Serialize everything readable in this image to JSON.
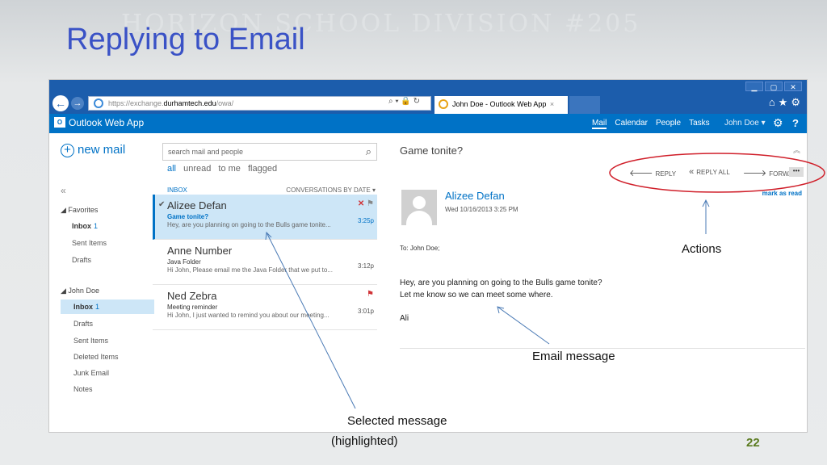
{
  "slide": {
    "title": "Replying to Email",
    "watermark": "HORIZON SCHOOL DIVISION #205",
    "page_number": "22"
  },
  "browser": {
    "url_prefix": "https://exchange.",
    "url_domain": "durhamtech.edu",
    "url_path": "/owa/",
    "tab_title": "John Doe - Outlook Web App",
    "tab_close": "×"
  },
  "owa": {
    "app_name": "Outlook Web App",
    "nav": [
      "Mail",
      "Calendar",
      "People",
      "Tasks"
    ],
    "user": "John Doe ▾"
  },
  "left_pane": {
    "new_mail": "new mail",
    "collapse": "«",
    "favorites_label": "◢ Favorites",
    "favorites": [
      {
        "label": "Inbox",
        "count": "1"
      },
      {
        "label": "Sent Items",
        "count": ""
      },
      {
        "label": "Drafts",
        "count": ""
      }
    ],
    "account_label": "◢ John Doe",
    "folders": [
      {
        "label": "Inbox",
        "count": "1"
      },
      {
        "label": "Drafts",
        "count": ""
      },
      {
        "label": "Sent Items",
        "count": ""
      },
      {
        "label": "Deleted Items",
        "count": ""
      },
      {
        "label": "Junk Email",
        "count": ""
      },
      {
        "label": "Notes",
        "count": ""
      }
    ]
  },
  "message_list": {
    "search_placeholder": "search mail and people",
    "filters": [
      "all",
      "unread",
      "to me",
      "flagged"
    ],
    "folder": "INBOX",
    "sort": "CONVERSATIONS BY DATE ▾",
    "messages": [
      {
        "sender": "Alizee Defan",
        "subject": "Game tonite?",
        "preview": "Hey, are you planning on going to the Bulls game tonite...",
        "time": "3:25p"
      },
      {
        "sender": "Anne Number",
        "subject": "Java Folder",
        "preview": "Hi John, Please email me the Java Folder that we put to...",
        "time": "3:12p"
      },
      {
        "sender": "Ned Zebra",
        "subject": "Meeting reminder",
        "preview": "Hi John, I just wanted to remind you about our meeting...",
        "time": "3:01p"
      }
    ]
  },
  "reading_pane": {
    "subject": "Game tonite?",
    "actions": [
      "REPLY",
      "REPLY ALL",
      "FORWARD"
    ],
    "more": "•••",
    "mark_as_read": "mark as read",
    "from_name": "Alizee Defan",
    "from_date": "Wed 10/16/2013 3:25 PM",
    "to": "To:  John Doe;",
    "body_line1": "Hey, are you planning on going to the Bulls game tonite?",
    "body_line2": "Let me know so we can meet some where.",
    "signature": "Ali"
  },
  "annotations": {
    "actions": "Actions",
    "email_message": "Email message",
    "selected_line1": "Selected message",
    "selected_line2": "(highlighted)"
  },
  "colors": {
    "title_blue": "#3a52c6",
    "owa_blue": "#0072c6",
    "browser_blue": "#1c5dac",
    "selected_bg": "#cde6f7",
    "flag_red": "#d13438",
    "page_number_green": "#5a7a1e"
  }
}
